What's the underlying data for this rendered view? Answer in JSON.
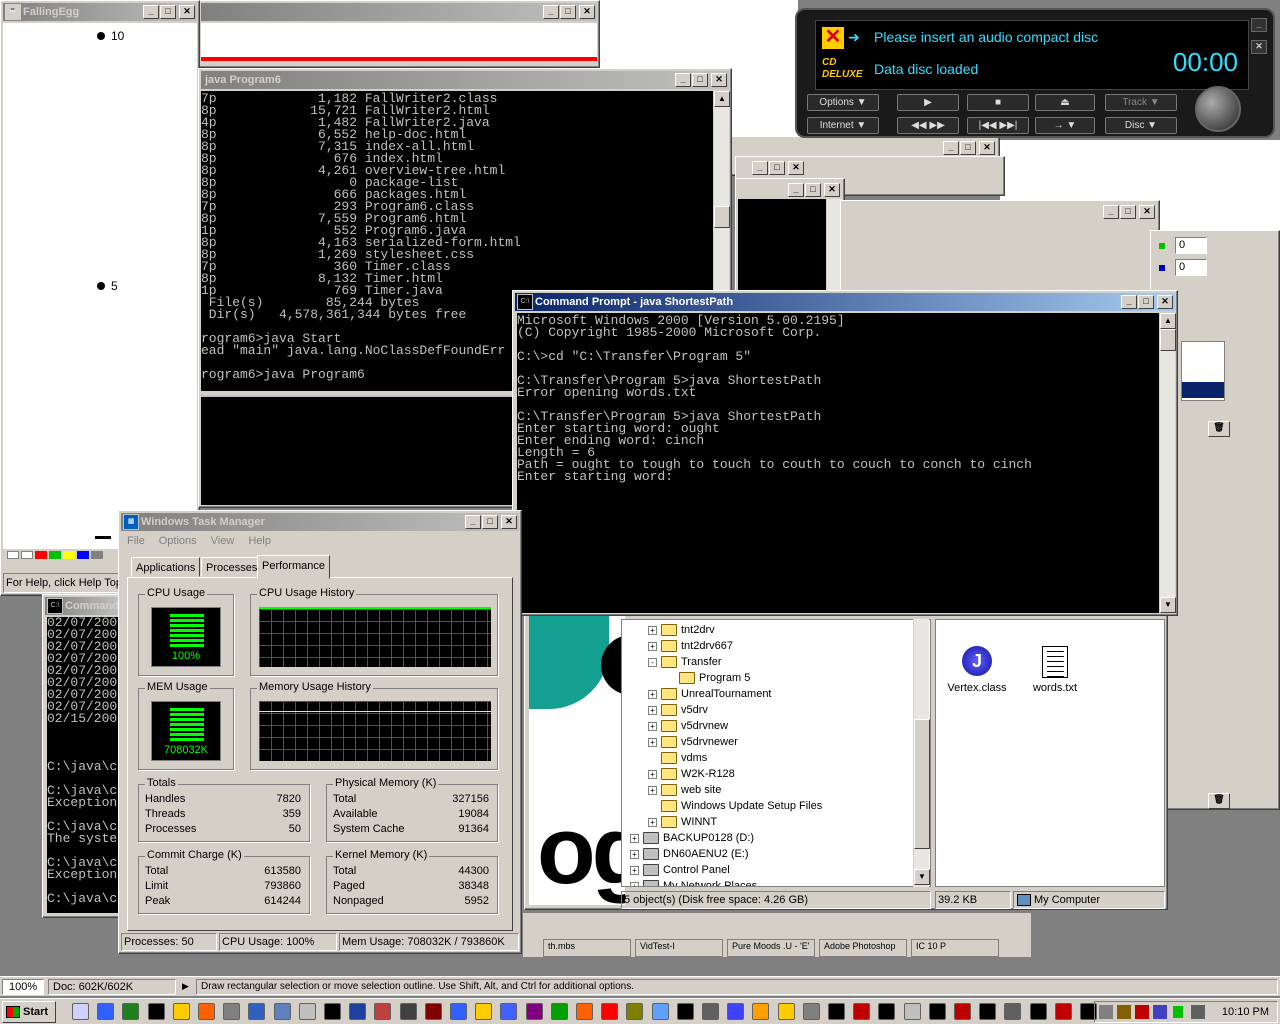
{
  "falling_egg": {
    "title": "FallingEgg",
    "label_top": "10",
    "label_mid": "5",
    "status": "For Help, click Help Topi"
  },
  "program6_console": {
    "title": "java Program6",
    "lines": [
      "7p             1,182 FallWriter2.class",
      "8p            15,721 FallWriter2.html",
      "4p             1,482 FallWriter2.java",
      "8p             6,552 help-doc.html",
      "8p             7,315 index-all.html",
      "8p               676 index.html",
      "8p             4,261 overview-tree.html",
      "8p                 0 package-list",
      "8p               666 packages.html",
      "7p               293 Program6.class",
      "8p             7,559 Program6.html",
      "1p               552 Program6.java",
      "8p             4,163 serialized-form.html",
      "8p             1,269 stylesheet.css",
      "7p               360 Timer.class",
      "8p             8,132 Timer.html",
      "1p               769 Timer.java",
      " File(s)        85,244 bytes",
      " Dir(s)   4,578,361,344 bytes free",
      "",
      "rogram6>java Start",
      "ead \"main\" java.lang.NoClassDefFoundErr",
      "",
      "rogram6>java Program6"
    ]
  },
  "cmd_shortest": {
    "title": "Command Prompt - java ShortestPath",
    "lines": [
      "Microsoft Windows 2000 [Version 5.00.2195]",
      "(C) Copyright 1985-2000 Microsoft Corp.",
      "",
      "C:\\>cd \"C:\\Transfer\\Program 5\"",
      "",
      "C:\\Transfer\\Program 5>java ShortestPath",
      "Error opening words.txt",
      "",
      "C:\\Transfer\\Program 5>java ShortestPath",
      "Enter starting word: ought",
      "Enter ending word: cinch",
      "Length = 6",
      "Path = ought to tough to touch to couth to couch to conch to cinch",
      "Enter starting word: "
    ]
  },
  "cmd_left": {
    "title": "Command",
    "lines": [
      "02/07/200",
      "02/07/200",
      "02/07/200",
      "02/07/200",
      "02/07/200",
      "02/07/200",
      "02/07/200",
      "02/07/200",
      "02/15/200",
      "",
      "",
      "",
      "C:\\java\\c",
      "",
      "C:\\java\\c",
      "Exception",
      "",
      "C:\\java\\c",
      "The syste",
      "",
      "C:\\java\\c",
      "Exception",
      "",
      "C:\\java\\c"
    ]
  },
  "cd_player": {
    "status1": "Please insert an audio compact disc",
    "status2": "Data disc loaded",
    "time": "00:00",
    "logo": "CD DELUXE",
    "buttons": {
      "options": "Options",
      "internet": "Internet",
      "track": "Track",
      "disc": "Disc"
    },
    "accent": "#33ddff"
  },
  "task_manager": {
    "title": "Windows Task Manager",
    "menu": [
      "File",
      "Options",
      "View",
      "Help"
    ],
    "tabs": [
      "Applications",
      "Processes",
      "Performance"
    ],
    "active_tab": "Performance",
    "cpu_usage_label": "CPU Usage",
    "cpu_usage_value": "100%",
    "cpu_history_label": "CPU Usage History",
    "mem_usage_label": "MEM Usage",
    "mem_usage_value": "708032K",
    "mem_history_label": "Memory Usage History",
    "totals": {
      "label": "Totals",
      "rows": [
        [
          "Handles",
          "7820"
        ],
        [
          "Threads",
          "359"
        ],
        [
          "Processes",
          "50"
        ]
      ]
    },
    "physical": {
      "label": "Physical Memory (K)",
      "rows": [
        [
          "Total",
          "327156"
        ],
        [
          "Available",
          "19084"
        ],
        [
          "System Cache",
          "91364"
        ]
      ]
    },
    "commit": {
      "label": "Commit Charge (K)",
      "rows": [
        [
          "Total",
          "613580"
        ],
        [
          "Limit",
          "793860"
        ],
        [
          "Peak",
          "614244"
        ]
      ]
    },
    "kernel": {
      "label": "Kernel Memory (K)",
      "rows": [
        [
          "Total",
          "44300"
        ],
        [
          "Paged",
          "38348"
        ],
        [
          "Nonpaged",
          "5952"
        ]
      ]
    },
    "status": {
      "processes": "Processes: 50",
      "cpu": "CPU Usage: 100%",
      "mem": "Mem Usage: 708032K / 793860K"
    },
    "graph_color": "#00ff00"
  },
  "explorer": {
    "tree": [
      {
        "label": "tnt2drv",
        "level": 2,
        "pm": "+"
      },
      {
        "label": "tnt2drv667",
        "level": 2,
        "pm": "+"
      },
      {
        "label": "Transfer",
        "level": 2,
        "pm": "-"
      },
      {
        "label": "Program 5",
        "level": 3,
        "pm": ""
      },
      {
        "label": "UnrealTournament",
        "level": 2,
        "pm": "+"
      },
      {
        "label": "v5drv",
        "level": 2,
        "pm": "+"
      },
      {
        "label": "v5drvnew",
        "level": 2,
        "pm": "+"
      },
      {
        "label": "v5drvnewer",
        "level": 2,
        "pm": "+"
      },
      {
        "label": "vdms",
        "level": 2,
        "pm": ""
      },
      {
        "label": "W2K-R128",
        "level": 2,
        "pm": "+"
      },
      {
        "label": "web site",
        "level": 2,
        "pm": "+"
      },
      {
        "label": "Windows Update Setup Files",
        "level": 2,
        "pm": ""
      },
      {
        "label": "WINNT",
        "level": 2,
        "pm": "+"
      },
      {
        "label": "BACKUP0128 (D:)",
        "level": 1,
        "pm": "+"
      },
      {
        "label": "DN60AENU2 (E:)",
        "level": 1,
        "pm": "+"
      },
      {
        "label": "Control Panel",
        "level": 1,
        "pm": "+"
      },
      {
        "label": "My Network Places",
        "level": 1,
        "pm": "+"
      }
    ],
    "files": [
      {
        "name": "Vertex.class",
        "icon": "java-icon"
      },
      {
        "name": "words.txt",
        "icon": "text-file-icon"
      }
    ],
    "status": {
      "objects": "5 object(s) (Disk free space: 4.26 GB)",
      "size": "39.2 KB",
      "location": "My Computer"
    }
  },
  "right_panel": {
    "field1": "0",
    "field2": "0"
  },
  "photoshop_status": {
    "zoom": "100%",
    "doc": "Doc: 602K/602K",
    "hint": "Draw rectangular selection or move selection outline.  Use Shift, Alt, and Ctrl for additional options."
  },
  "background_taskbar": [
    "th.mbs",
    "VidTest-I",
    "Pure Moods .U - 'E'",
    "Adobe Photoshop",
    "IC 10 P"
  ],
  "taskbar": {
    "start": "Start",
    "clock": "10:10 PM"
  }
}
